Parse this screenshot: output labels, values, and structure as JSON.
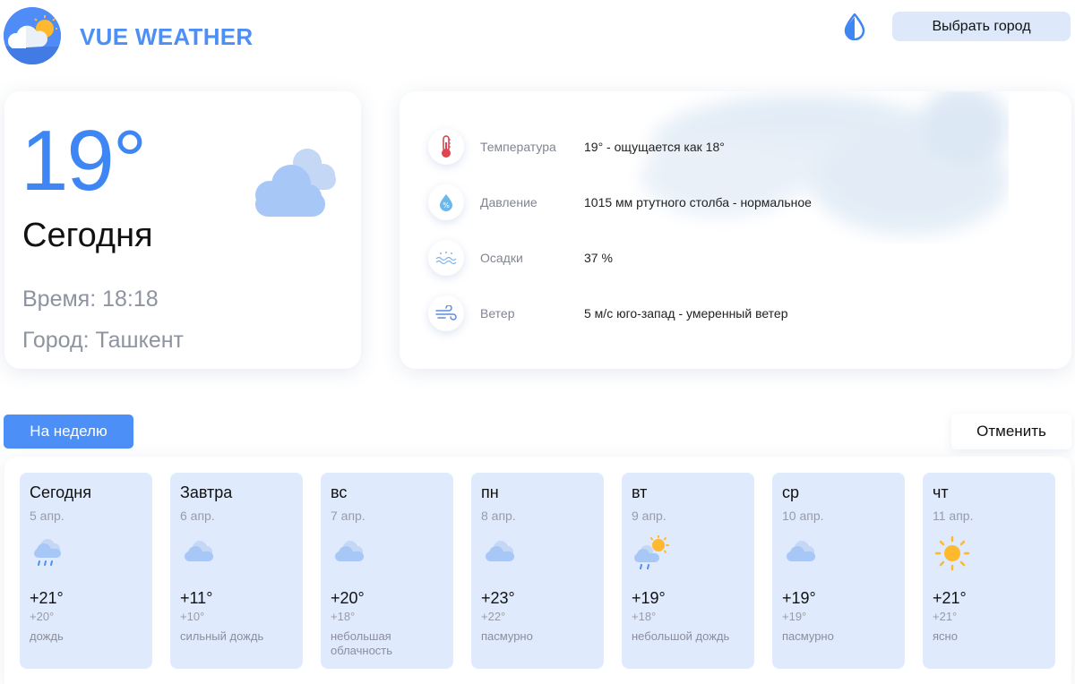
{
  "header": {
    "brand": "VUE WEATHER",
    "logo_icon": "cloud-sun-logo-icon",
    "theme_icon": "water-drop-icon",
    "city_button": "Выбрать город"
  },
  "today": {
    "temperature": "19°",
    "title": "Сегодня",
    "time": "Время: 18:18",
    "city": "Город: Ташкент",
    "icon": "cloud-icon"
  },
  "details": [
    {
      "icon": "thermometer-icon",
      "label": "Температура",
      "value": "19° - ощущается как 18°"
    },
    {
      "icon": "pressure-drop-icon",
      "label": "Давление",
      "value": "1015 мм ртутного столба - нормальное"
    },
    {
      "icon": "precipitation-icon",
      "label": "Осадки",
      "value": "37 %"
    },
    {
      "icon": "wind-icon",
      "label": "Ветер",
      "value": "5 м/с юго-запад - умеренный ветер"
    }
  ],
  "tabs": {
    "week": "На неделю",
    "cancel": "Отменить"
  },
  "forecast": [
    {
      "day": "Сегодня",
      "date": "5 апр.",
      "temp": "+21°",
      "feels": "+20°",
      "desc": "дождь",
      "icon": "rain-icon"
    },
    {
      "day": "Завтра",
      "date": "6 апр.",
      "temp": "+11°",
      "feels": "+10°",
      "desc": "сильный дождь",
      "icon": "cloud-icon"
    },
    {
      "day": "вс",
      "date": "7 апр.",
      "temp": "+20°",
      "feels": "+18°",
      "desc": "небольшая облачность",
      "icon": "cloud-icon"
    },
    {
      "day": "пн",
      "date": "8 апр.",
      "temp": "+23°",
      "feels": "+22°",
      "desc": "пасмурно",
      "icon": "cloud-icon"
    },
    {
      "day": "вт",
      "date": "9 апр.",
      "temp": "+19°",
      "feels": "+18°",
      "desc": "небольшой дождь",
      "icon": "sun-rain-icon"
    },
    {
      "day": "ср",
      "date": "10 апр.",
      "temp": "+19°",
      "feels": "+19°",
      "desc": "пасмурно",
      "icon": "cloud-icon"
    },
    {
      "day": "чт",
      "date": "11 апр.",
      "temp": "+21°",
      "feels": "+21°",
      "desc": "ясно",
      "icon": "sun-icon"
    }
  ],
  "colors": {
    "accent": "#4b8ff7",
    "card_bg": "#dfeafd",
    "muted_text": "#8d93a0"
  }
}
